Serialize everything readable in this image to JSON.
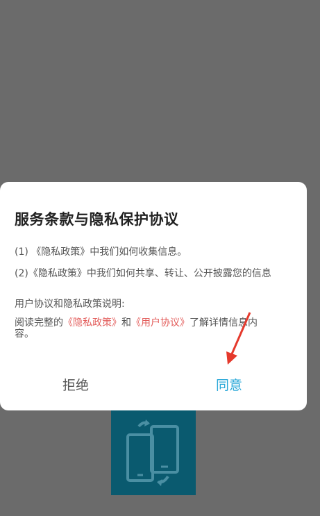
{
  "dialog": {
    "title": "服务条款与隐私保护协议",
    "items": [
      "(1) 《隐私政策》中我们如何收集信息。",
      "(2)《隐私政策》中我们如何共享、转让、公开披露您的信息"
    ],
    "section_label": "用户协议和隐私政策说明:",
    "description": {
      "prefix": "阅读完整的",
      "privacy_link": "《隐私政策》",
      "conjunction": "和",
      "user_agreement_link": "《用户协议》",
      "suffix": "了解详情信息内容。"
    },
    "reject_label": "拒绝",
    "agree_label": "同意"
  },
  "background_app": {
    "icon": "phone-transfer-icon"
  },
  "colors": {
    "overlay": "#6b6b6b",
    "link": "#e35d5b",
    "agree": "#29a8d8",
    "annotation_arrow": "#e5392c"
  }
}
